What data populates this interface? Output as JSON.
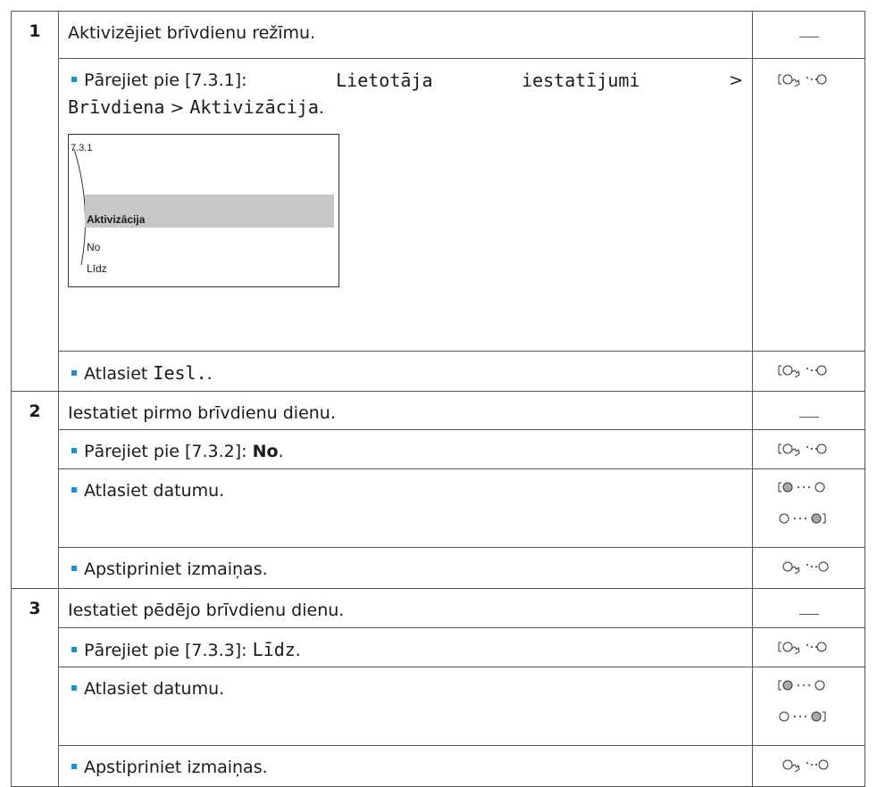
{
  "steps": [
    {
      "number": "1",
      "title": "Aktivizējiet brīvdienu režīmu.",
      "sub_nav_prefix": "Pārejiet pie [7.3.1]:",
      "sub_nav_path_1": "Lietotāja",
      "sub_nav_path_2": "iestatījumi",
      "sub_nav_gt": ">",
      "sub_nav_path_3": "Brīvdiena",
      "sub_nav_path_4": "Aktivizācija",
      "screen": {
        "code": "7.3.1",
        "highlight": "Aktivizācija",
        "item1": "No",
        "item2": "Līdz"
      },
      "select_prefix": "Atlasiet",
      "select_value": "Iesl.",
      "select_suffix": "."
    },
    {
      "number": "2",
      "title": "Iestatiet pirmo brīvdienu dienu.",
      "nav_prefix": "Pārejiet pie [7.3.2]:",
      "nav_value": "No",
      "date_label": "Atlasiet datumu.",
      "confirm_label": "Apstipriniet izmaiņas."
    },
    {
      "number": "3",
      "title": "Iestatiet pēdējo brīvdienu dienu.",
      "nav_prefix": "Pārejiet pie [7.3.3]:",
      "nav_value": "Līdz",
      "date_label": "Atlasiet datumu.",
      "confirm_label": "Apstipriniet izmaiņas."
    }
  ],
  "icons": {
    "dash": "em-dash",
    "turn_press_left": "left-dial-turn-press-icon",
    "turn_left": "left-dial-turn-icon",
    "turn_right": "right-dial-turn-icon",
    "press_left": "left-dial-press-icon"
  },
  "colors": {
    "bullet": "#1a8fd6",
    "highlight": "#c6c6c6"
  }
}
